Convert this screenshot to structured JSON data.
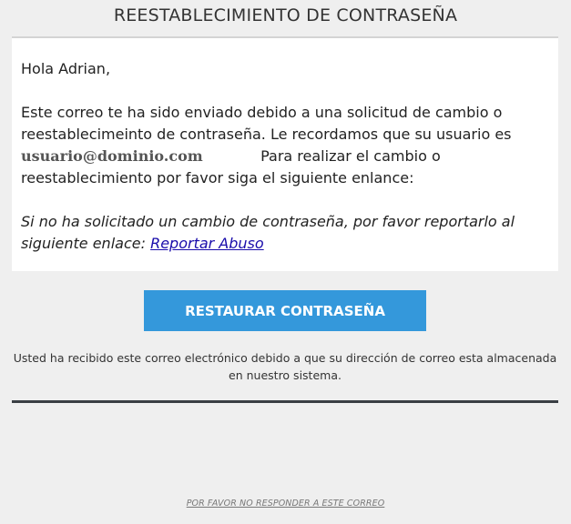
{
  "header": {
    "title": "REESTABLECIMIENTO DE CONTRASEÑA"
  },
  "message": {
    "greeting": "Hola Adrian,",
    "body_part1": "Este correo te ha sido enviado debido a una solicitud de cambio o reestablecimeinto de contraseña. Le recordamos que su usuario es",
    "username": "usuario@dominio.com",
    "body_part2": "Para realizar el cambio o reestablecimiento por favor siga el siguiente enlance:",
    "note_text": "Si no ha solicitado un cambio de contraseña, por favor reportarlo al siguiente enlace:",
    "report_link": "Reportar Abuso"
  },
  "action": {
    "button_label": "RESTAURAR CONTRASEÑA"
  },
  "footer": {
    "notice": "Usted ha recibido este correo electrónico debido a que su dirección de correo esta almacenada en nuestro sistema.",
    "no_reply": "POR FAVOR NO RESPONDER A ESTE CORREO"
  }
}
